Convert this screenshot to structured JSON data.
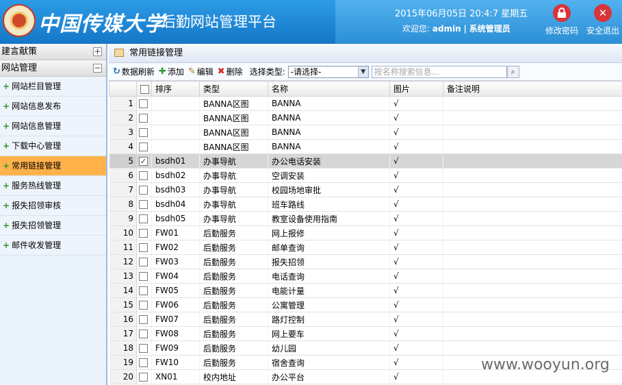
{
  "header": {
    "university": "中国传媒大学",
    "platform": "后勤网站管理平台",
    "datetime": "2015年06月05日 20:4:7 星期五",
    "welcome_prefix": "欢迎您:",
    "username": "admin",
    "separator": "|",
    "role": "系统管理员",
    "change_password": "修改密码",
    "logout": "安全退出"
  },
  "sidebar": {
    "groups": [
      {
        "label": "建言献策",
        "toggle": "+"
      },
      {
        "label": "网站管理",
        "toggle": "−"
      }
    ],
    "items": [
      {
        "label": "网站栏目管理"
      },
      {
        "label": "网站信息发布"
      },
      {
        "label": "网站信息管理"
      },
      {
        "label": "下载中心管理"
      },
      {
        "label": "常用链接管理"
      },
      {
        "label": "服务热线管理"
      },
      {
        "label": "报失招领审核"
      },
      {
        "label": "报失招领管理"
      },
      {
        "label": "邮件收发管理"
      }
    ]
  },
  "main": {
    "title": "常用链接管理",
    "toolbar": {
      "refresh": "数据刷新",
      "add": "添加",
      "edit": "编辑",
      "delete": "删除",
      "type_label": "选择类型:",
      "type_value": "-请选择-",
      "search_placeholder": "按名称搜索信息..."
    },
    "columns": [
      "排序",
      "类型",
      "名称",
      "图片",
      "备注说明"
    ],
    "rows": [
      {
        "n": "1",
        "order": "",
        "type": "BANNA区图",
        "name": "BANNA",
        "pic": "√",
        "note": ""
      },
      {
        "n": "2",
        "order": "",
        "type": "BANNA区图",
        "name": "BANNA",
        "pic": "√",
        "note": ""
      },
      {
        "n": "3",
        "order": "",
        "type": "BANNA区图",
        "name": "BANNA",
        "pic": "√",
        "note": ""
      },
      {
        "n": "4",
        "order": "",
        "type": "BANNA区图",
        "name": "BANNA",
        "pic": "√",
        "note": ""
      },
      {
        "n": "5",
        "order": "bsdh01",
        "type": "办事导航",
        "name": "办公电话安装",
        "pic": "√",
        "note": ""
      },
      {
        "n": "6",
        "order": "bsdh02",
        "type": "办事导航",
        "name": "空调安装",
        "pic": "√",
        "note": ""
      },
      {
        "n": "7",
        "order": "bsdh03",
        "type": "办事导航",
        "name": "校园场地审批",
        "pic": "√",
        "note": ""
      },
      {
        "n": "8",
        "order": "bsdh04",
        "type": "办事导航",
        "name": "班车路线",
        "pic": "√",
        "note": ""
      },
      {
        "n": "9",
        "order": "bsdh05",
        "type": "办事导航",
        "name": "教室设备使用指南",
        "pic": "√",
        "note": ""
      },
      {
        "n": "10",
        "order": "FW01",
        "type": "后勤服务",
        "name": "网上报修",
        "pic": "√",
        "note": ""
      },
      {
        "n": "11",
        "order": "FW02",
        "type": "后勤服务",
        "name": "邮单查询",
        "pic": "√",
        "note": ""
      },
      {
        "n": "12",
        "order": "FW03",
        "type": "后勤服务",
        "name": "报失招领",
        "pic": "√",
        "note": ""
      },
      {
        "n": "13",
        "order": "FW04",
        "type": "后勤服务",
        "name": "电话查询",
        "pic": "√",
        "note": ""
      },
      {
        "n": "14",
        "order": "FW05",
        "type": "后勤服务",
        "name": "电能计量",
        "pic": "√",
        "note": ""
      },
      {
        "n": "15",
        "order": "FW06",
        "type": "后勤服务",
        "name": "公寓管理",
        "pic": "√",
        "note": ""
      },
      {
        "n": "16",
        "order": "FW07",
        "type": "后勤服务",
        "name": "路灯控制",
        "pic": "√",
        "note": ""
      },
      {
        "n": "17",
        "order": "FW08",
        "type": "后勤服务",
        "name": "网上要车",
        "pic": "√",
        "note": ""
      },
      {
        "n": "18",
        "order": "FW09",
        "type": "后勤服务",
        "name": "幼儿园",
        "pic": "√",
        "note": ""
      },
      {
        "n": "19",
        "order": "FW10",
        "type": "后勤服务",
        "name": "宿舍查询",
        "pic": "√",
        "note": ""
      },
      {
        "n": "20",
        "order": "XN01",
        "type": "校内地址",
        "name": "办公平台",
        "pic": "√",
        "note": ""
      }
    ],
    "selected_row": "5"
  },
  "watermark": "www.wooyun.org"
}
